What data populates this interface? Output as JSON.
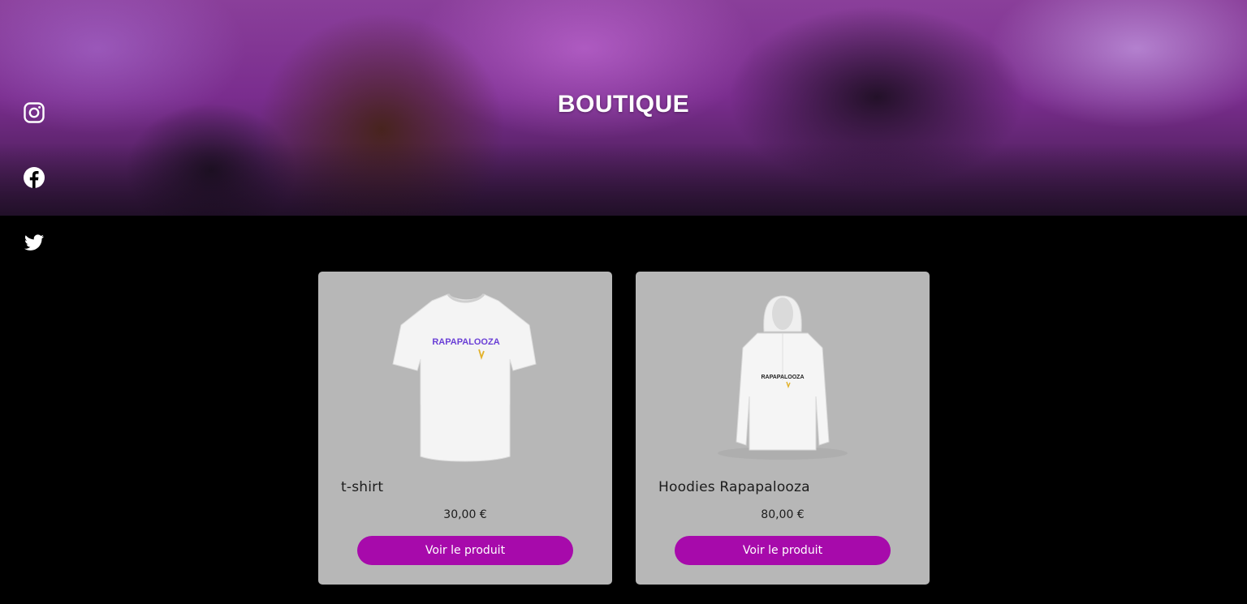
{
  "hero": {
    "title": "BOUTIQUE"
  },
  "social": {
    "icons": [
      "instagram-icon",
      "facebook-icon",
      "twitter-icon"
    ],
    "color": "#ffffff"
  },
  "products": [
    {
      "name": "t-shirt",
      "price": "30,00 €",
      "button_label": "Voir le produit",
      "print_text": "RAPAPALOOZA"
    },
    {
      "name": "Hoodies Rapapalooza",
      "price": "80,00 €",
      "button_label": "Voir le produit",
      "print_text": "RAPAPALOOZA"
    }
  ],
  "colors": {
    "background": "#000000",
    "card": "#b7b7b7",
    "button": "#a70aab",
    "button_text": "#ffffff"
  }
}
